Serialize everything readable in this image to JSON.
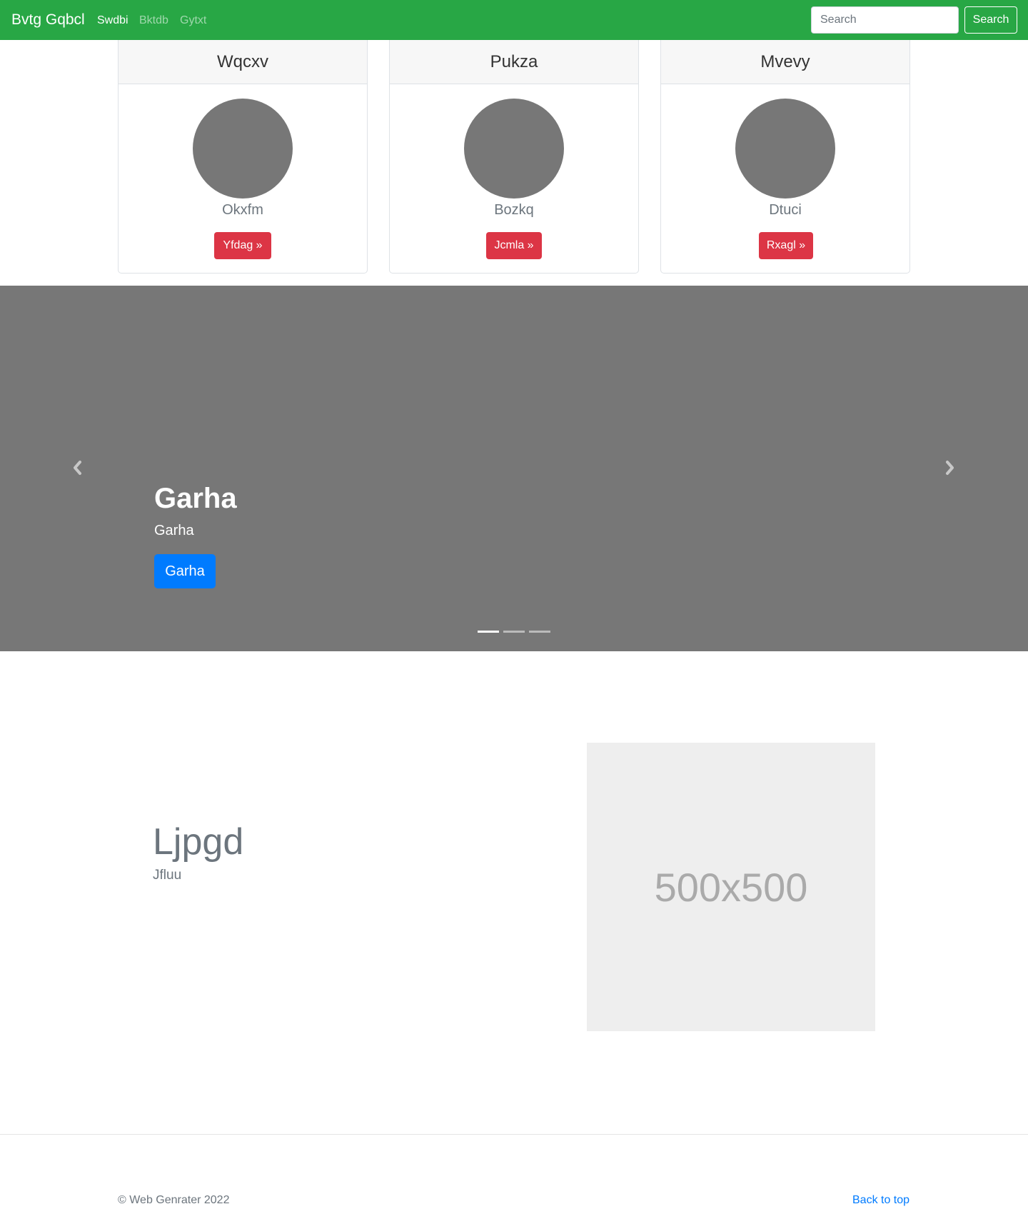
{
  "navbar": {
    "brand": "Bvtg Gqbcl",
    "links": [
      {
        "label": "Swdbi",
        "active": true
      },
      {
        "label": "Bktdb",
        "active": false
      },
      {
        "label": "Gytxt",
        "active": false
      }
    ],
    "search_placeholder": "Search",
    "search_button": "Search",
    "bg_color": "#28a745"
  },
  "cards": [
    {
      "header": "Wqcxv",
      "name": "Okxfm",
      "button": "Yfdag »"
    },
    {
      "header": "Pukza",
      "name": "Bozkq",
      "button": "Jcmla »"
    },
    {
      "header": "Mvevy",
      "name": "Dtuci",
      "button": "Rxagl »"
    }
  ],
  "card_button_color": "#dc3545",
  "carousel": {
    "title": "Garha",
    "text": "Garha",
    "button": "Garha",
    "prev_icon": "chevron-left-icon",
    "next_icon": "chevron-right-icon",
    "slide_count": 3,
    "active_slide": 1,
    "button_color": "#007bff"
  },
  "feature": {
    "heading": "Ljpgd",
    "subheading": "Jfluu",
    "image_label": "500x500"
  },
  "footer": {
    "copyright": "© Web Genrater 2022",
    "back_to_top": "Back to top"
  }
}
